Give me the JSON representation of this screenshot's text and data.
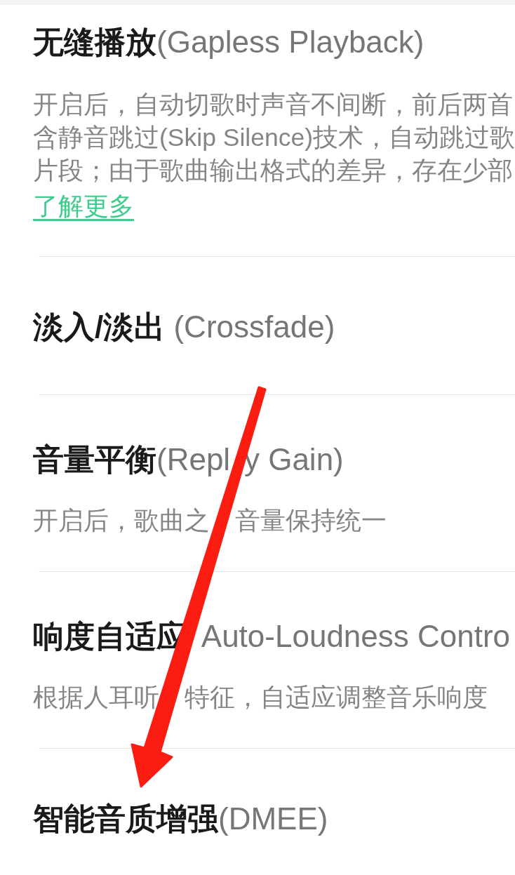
{
  "settings": [
    {
      "title": [
        "**无缝播放**(Gapless Playback)"
      ],
      "description_lines": [
        [
          "开启后，自动切歌时声音不间断，前后两首"
        ],
        [
          "含静音跳过(Skip Silence)技术，自动跳过歌"
        ],
        [
          "片段；由于歌曲输出格式的差异，存在少部"
        ]
      ],
      "link": "了解更多"
    },
    {
      "title": [
        "**淡入/淡出** (Crossfade)"
      ]
    },
    {
      "title": [
        "**音量平衡**(Repl",
        "y Gain)"
      ],
      "description_lines": [
        [
          "开启后，歌曲之",
          "音量保持统一"
        ]
      ]
    },
    {
      "title": [
        "**响度自适应**",
        "Auto-Loudness Contro"
      ],
      "description_lines": [
        [
          "根据人耳听",
          "特征，自适应调整音乐响度"
        ]
      ]
    },
    {
      "title": [
        "**智能音质增强**(DMEE)"
      ]
    }
  ]
}
